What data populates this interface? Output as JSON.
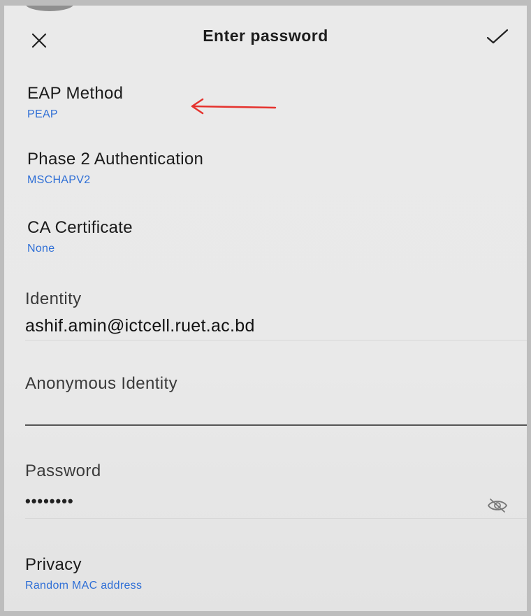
{
  "header": {
    "title": "Enter password",
    "close_icon": "close-icon",
    "confirm_icon": "checkmark-icon"
  },
  "settings": {
    "eap_method": {
      "label": "EAP Method",
      "value": "PEAP"
    },
    "phase2": {
      "label": "Phase 2 Authentication",
      "value": "MSCHAPV2"
    },
    "ca_certificate": {
      "label": "CA Certificate",
      "value": "None"
    },
    "identity": {
      "label": "Identity",
      "value": "ashif.amin@ictcell.ruet.ac.bd"
    },
    "anonymous_identity": {
      "label": "Anonymous Identity",
      "value": ""
    },
    "password": {
      "label": "Password",
      "value": "••••••••",
      "visibility_icon": "eye-off-icon"
    },
    "privacy": {
      "label": "Privacy",
      "value": "Random MAC address"
    }
  },
  "annotation": {
    "arrow_color": "#e5322d",
    "icon": "arrow-left-icon"
  },
  "colors": {
    "accent": "#2f6fd6",
    "background": "#e9e9e9"
  }
}
